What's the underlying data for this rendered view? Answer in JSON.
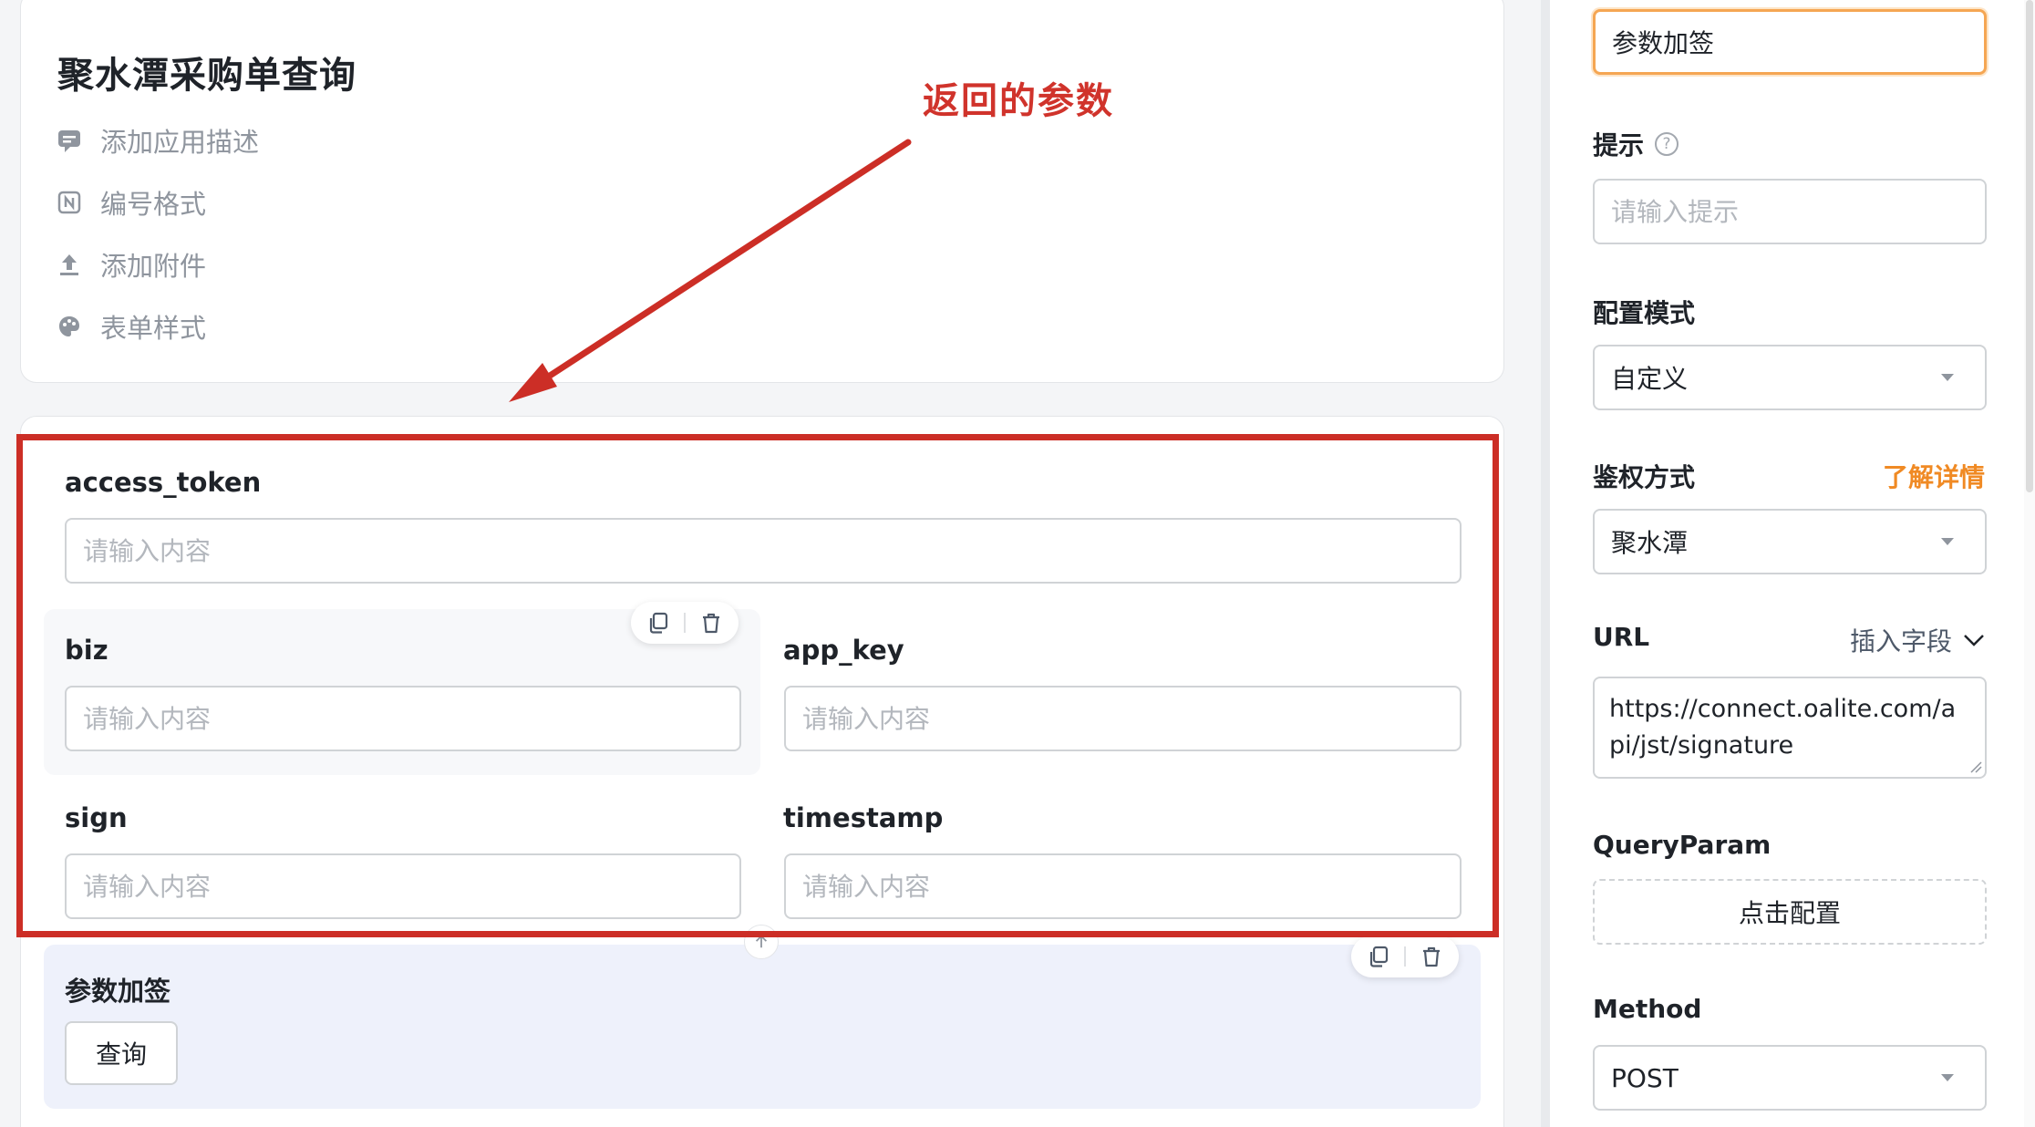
{
  "app": {
    "title": "聚水潭采购单查询",
    "menu": [
      {
        "label": "添加应用描述",
        "icon": "comment-icon"
      },
      {
        "label": "编号格式",
        "icon": "numbering-icon"
      },
      {
        "label": "添加附件",
        "icon": "upload-icon"
      },
      {
        "label": "表单样式",
        "icon": "palette-icon"
      }
    ]
  },
  "annotation": {
    "text": "返回的参数",
    "color": "#cc2e26"
  },
  "form": {
    "fields": [
      {
        "label": "access_token",
        "placeholder": "请输入内容"
      },
      {
        "label": "biz",
        "placeholder": "请输入内容"
      },
      {
        "label": "app_key",
        "placeholder": "请输入内容"
      },
      {
        "label": "sign",
        "placeholder": "请输入内容"
      },
      {
        "label": "timestamp",
        "placeholder": "请输入内容"
      }
    ],
    "sign_block": {
      "label": "参数加签",
      "button_label": "查询"
    }
  },
  "panel": {
    "title_value": "参数加签",
    "hint_label": "提示",
    "hint_placeholder": "请输入提示",
    "config_mode_label": "配置模式",
    "config_mode_value": "自定义",
    "auth_label": "鉴权方式",
    "auth_link": "了解详情",
    "auth_value": "聚水潭",
    "url_label": "URL",
    "insert_field_label": "插入字段",
    "url_value": "https://connect.oalite.com/api/jst/signature",
    "query_param_label": "QueryParam",
    "config_button_label": "点击配置",
    "method_label": "Method",
    "method_value": "POST"
  },
  "colors": {
    "accent_orange": "#f08a24",
    "focus_border": "#f5a653",
    "highlight_red": "#cc2e26"
  }
}
